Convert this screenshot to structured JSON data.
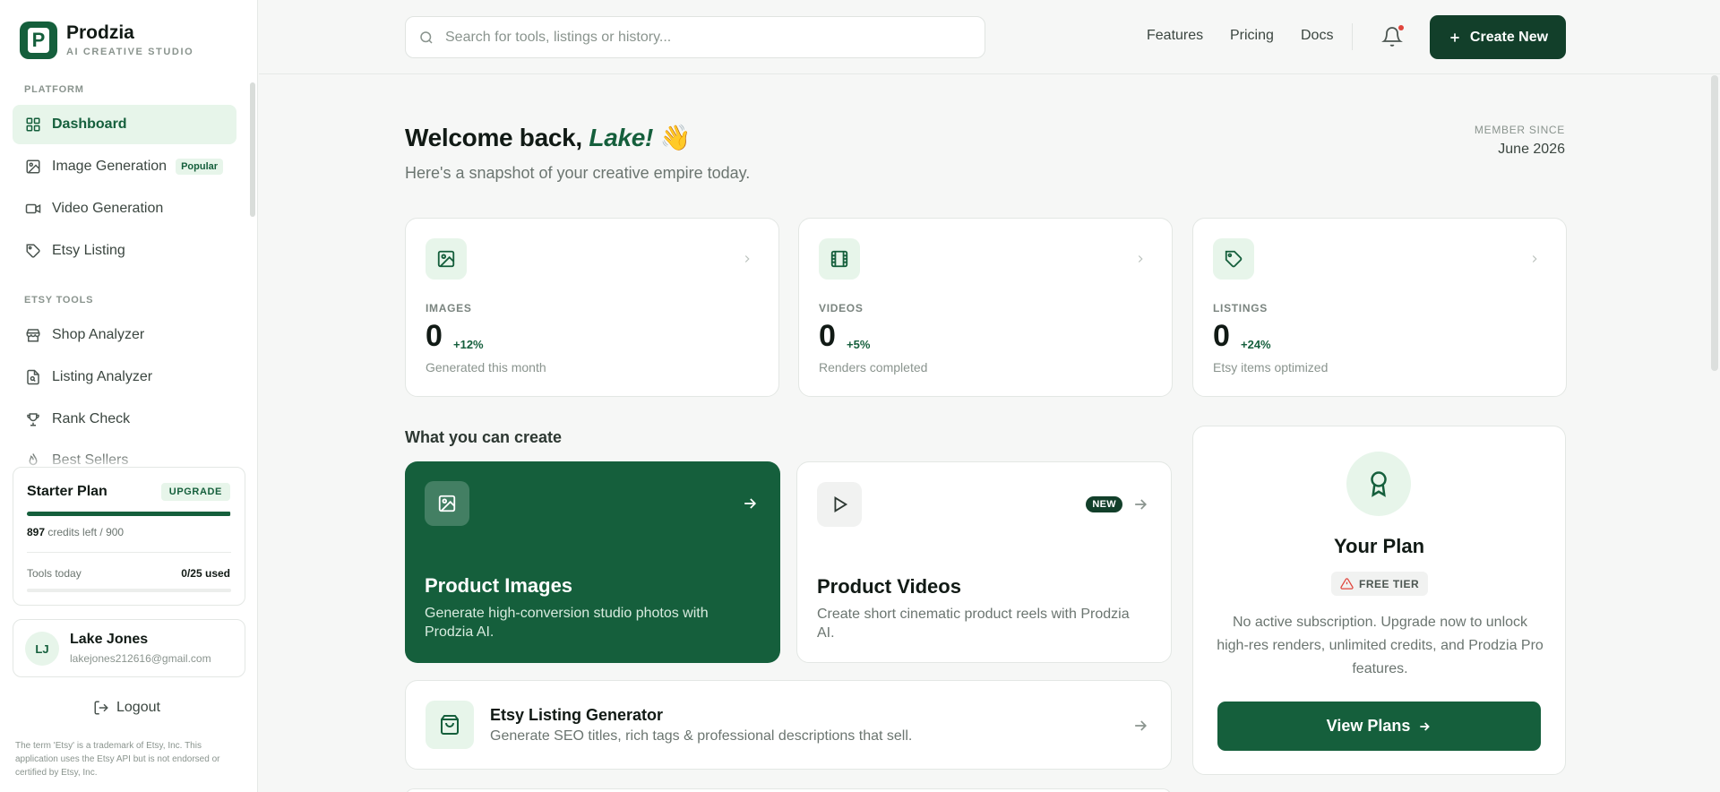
{
  "brand": {
    "name": "Prodzia",
    "subtitle": "AI CREATIVE STUDIO",
    "logo_letter": "P"
  },
  "sidebar": {
    "platform_label": "PLATFORM",
    "platform_items": [
      {
        "label": "Dashboard",
        "icon": "grid-icon",
        "active": true
      },
      {
        "label": "Image Generation",
        "icon": "image-icon",
        "badge": "Popular"
      },
      {
        "label": "Video Generation",
        "icon": "video-icon"
      },
      {
        "label": "Etsy Listing",
        "icon": "tag-icon"
      }
    ],
    "etsy_tools_label": "ETSY TOOLS",
    "etsy_items": [
      {
        "label": "Shop Analyzer",
        "icon": "store-icon"
      },
      {
        "label": "Listing Analyzer",
        "icon": "file-search-icon"
      },
      {
        "label": "Rank Check",
        "icon": "trophy-icon"
      },
      {
        "label": "Best Sellers",
        "icon": "flame-icon"
      }
    ]
  },
  "plan": {
    "title": "Starter Plan",
    "upgrade_label": "UPGRADE",
    "credits_left": "897",
    "credits_text": "credits left / 900",
    "credits_fraction": 0.997,
    "tools_label": "Tools today",
    "tools_value": "0/25 used"
  },
  "user": {
    "initials": "LJ",
    "name": "Lake Jones",
    "email": "lakejones212616@gmail.com"
  },
  "logout_label": "Logout",
  "disclaimer": "The term 'Etsy' is a trademark of Etsy, Inc. This application uses the Etsy API but is not endorsed or certified by Etsy, Inc.",
  "topbar": {
    "search_placeholder": "Search for tools, listings or history...",
    "links": [
      "Features",
      "Pricing",
      "Docs"
    ],
    "create_label": "Create New"
  },
  "welcome": {
    "greeting": "Welcome back, ",
    "name": "Lake!",
    "emoji": "👋",
    "subtitle": "Here's a snapshot of your creative empire today.",
    "member_since_label": "MEMBER SINCE",
    "member_since_value": "June 2026"
  },
  "stats": [
    {
      "label": "IMAGES",
      "value": "0",
      "delta": "+12%",
      "desc": "Generated this month",
      "icon": "image-icon"
    },
    {
      "label": "VIDEOS",
      "value": "0",
      "delta": "+5%",
      "desc": "Renders completed",
      "icon": "film-icon"
    },
    {
      "label": "LISTINGS",
      "value": "0",
      "delta": "+24%",
      "desc": "Etsy items optimized",
      "icon": "tag-icon"
    }
  ],
  "create_section": {
    "title": "What you can create",
    "cards": [
      {
        "title": "Product Images",
        "desc": "Generate high-conversion studio photos with Prodzia AI."
      },
      {
        "title": "Product Videos",
        "desc": "Create short cinematic product reels with Prodzia AI.",
        "badge": "NEW"
      }
    ],
    "etsy": {
      "title": "Etsy Listing Generator",
      "desc": "Generate SEO titles, rich tags & professional descriptions that sell."
    }
  },
  "plan_panel": {
    "title": "Your Plan",
    "tier": "FREE TIER",
    "desc": "No active subscription. Upgrade now to unlock high-res renders, unlimited credits, and Prodzia Pro features.",
    "cta": "View Plans"
  },
  "colors": {
    "brand_green": "#155f3c",
    "dark_green": "#123f2a",
    "light_green": "#e7f5ea",
    "alert_red": "#e0453c"
  }
}
